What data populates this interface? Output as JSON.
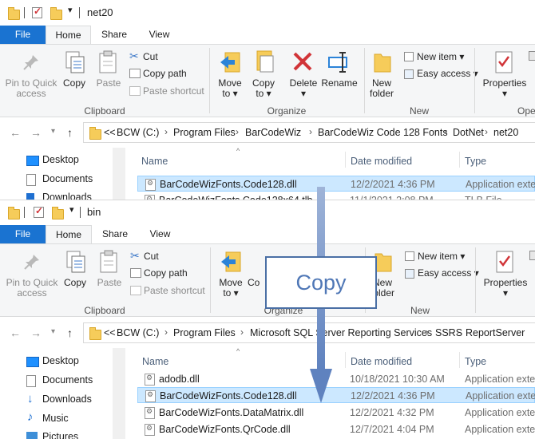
{
  "top_window": {
    "title": "net20",
    "tabs": [
      "File",
      "Home",
      "Share",
      "View"
    ],
    "ribbon": {
      "pin": "Pin to Quick access",
      "copy": "Copy",
      "paste": "Paste",
      "cut": "Cut",
      "copy_path": "Copy path",
      "paste_shortcut": "Paste shortcut",
      "move_to": "Move to",
      "copy_to": "Copy to",
      "delete": "Delete",
      "rename": "Rename",
      "new_folder": "New folder",
      "new_item": "New item",
      "easy_access": "Easy access",
      "properties": "Properties",
      "open_group": "Ope",
      "groups": [
        "Clipboard",
        "Organize",
        "New"
      ]
    },
    "address": [
      "<<",
      "BCW (C:)",
      "Program Files",
      "BarCodeWiz",
      "BarCodeWiz Code 128 Fonts",
      "DotNet",
      "net20"
    ],
    "nav": [
      "Desktop",
      "Documents",
      "Downloads"
    ],
    "columns": [
      "Name",
      "Date modified",
      "Type"
    ],
    "files": [
      {
        "name": "BarCodeWizFonts.Code128.dll",
        "date": "12/2/2021 4:36 PM",
        "type": "Application exte",
        "selected": true
      },
      {
        "name": "BarCodeWizFonts.Code128x64.tlb",
        "date": "11/1/2021 2:08 PM",
        "type": "TLB File",
        "selected": false
      }
    ]
  },
  "bottom_window": {
    "title": "bin",
    "tabs": [
      "File",
      "Home",
      "Share",
      "View"
    ],
    "ribbon": {
      "pin": "Pin to Quick access",
      "copy": "Copy",
      "paste": "Paste",
      "cut": "Cut",
      "copy_path": "Copy path",
      "paste_shortcut": "Paste shortcut",
      "move_to": "Move to",
      "copy_to": "Co",
      "new_folder": "New folder",
      "new_item": "New item",
      "easy_access": "Easy access",
      "properties": "Properties",
      "groups": [
        "Clipboard",
        "Organize",
        "New"
      ]
    },
    "address": [
      "<<",
      "BCW (C:)",
      "Program Files",
      "Microsoft SQL Server Reporting Services",
      "SSRS",
      "ReportServer"
    ],
    "nav": [
      "Desktop",
      "Documents",
      "Downloads",
      "Music",
      "Pictures"
    ],
    "columns": [
      "Name",
      "Date modified",
      "Type"
    ],
    "files": [
      {
        "name": "adodb.dll",
        "date": "10/18/2021 10:30 AM",
        "type": "Application exte",
        "selected": false
      },
      {
        "name": "BarCodeWizFonts.Code128.dll",
        "date": "12/2/2021 4:36 PM",
        "type": "Application exte",
        "selected": true
      },
      {
        "name": "BarCodeWizFonts.DataMatrix.dll",
        "date": "12/2/2021 4:32 PM",
        "type": "Application exte",
        "selected": false
      },
      {
        "name": "BarCodeWizFonts.QrCode.dll",
        "date": "12/7/2021 4:04 PM",
        "type": "Application exte",
        "selected": false
      }
    ]
  },
  "overlay": {
    "label": "Copy",
    "arrow_color": "#6b8cc2"
  },
  "colors": {
    "file_tab": "#1a73d1",
    "selection": "#cce8ff",
    "delete_red": "#d13438"
  }
}
